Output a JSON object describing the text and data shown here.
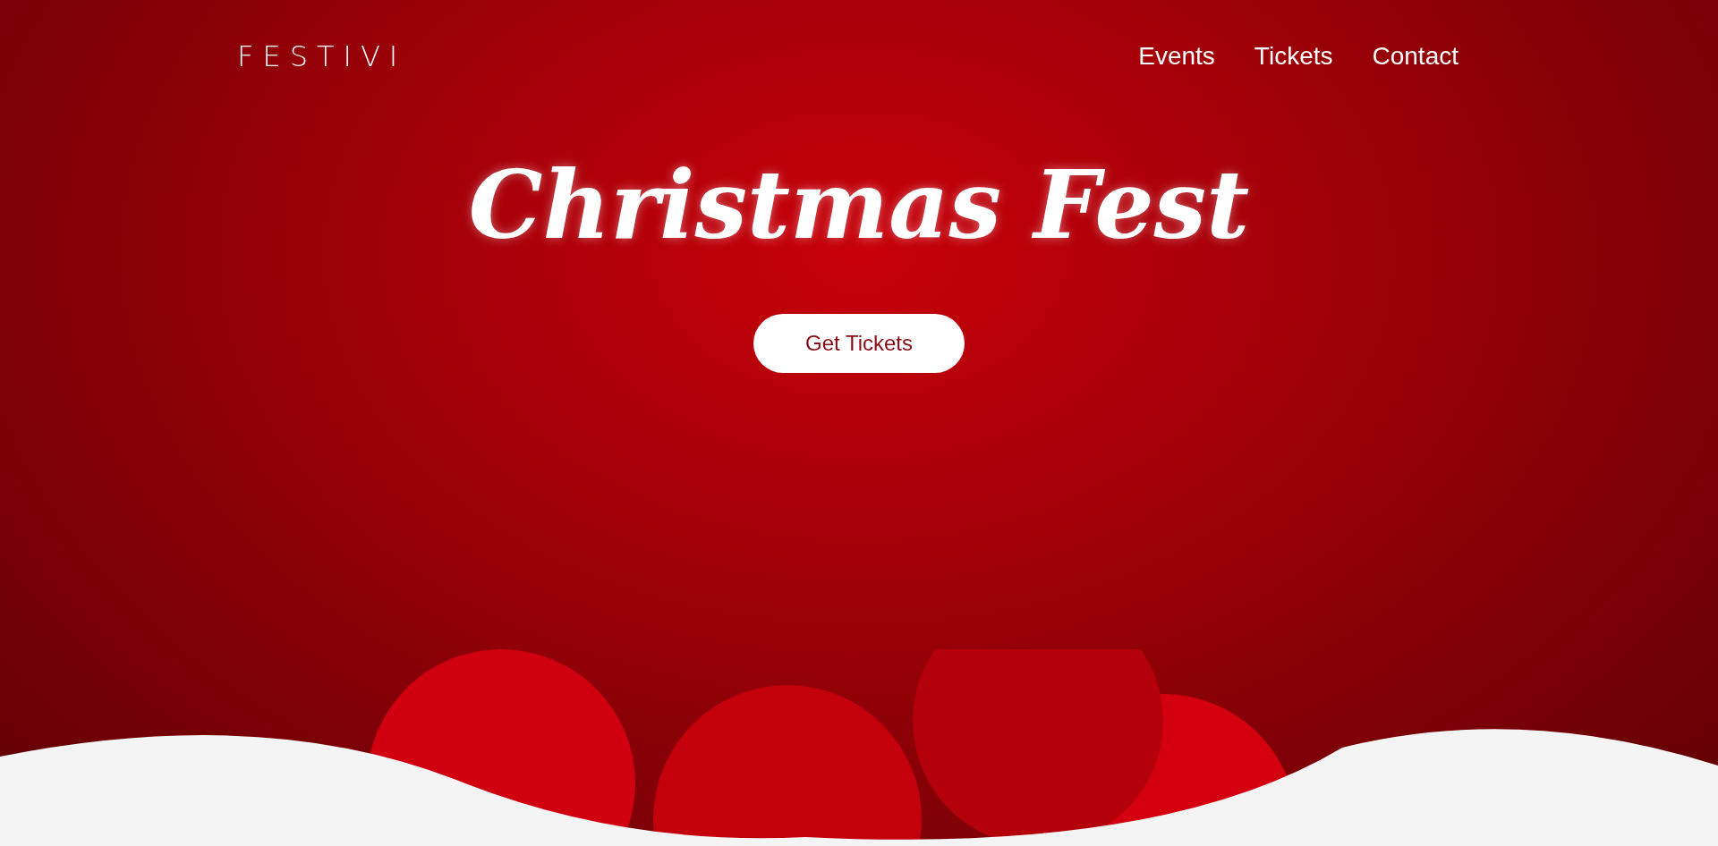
{
  "header": {
    "logo": "FESTIVI",
    "nav": [
      {
        "label": "Events"
      },
      {
        "label": "Tickets"
      },
      {
        "label": "Contact"
      }
    ]
  },
  "hero": {
    "title": "Christmas Fest",
    "button": "Get Tickets"
  }
}
